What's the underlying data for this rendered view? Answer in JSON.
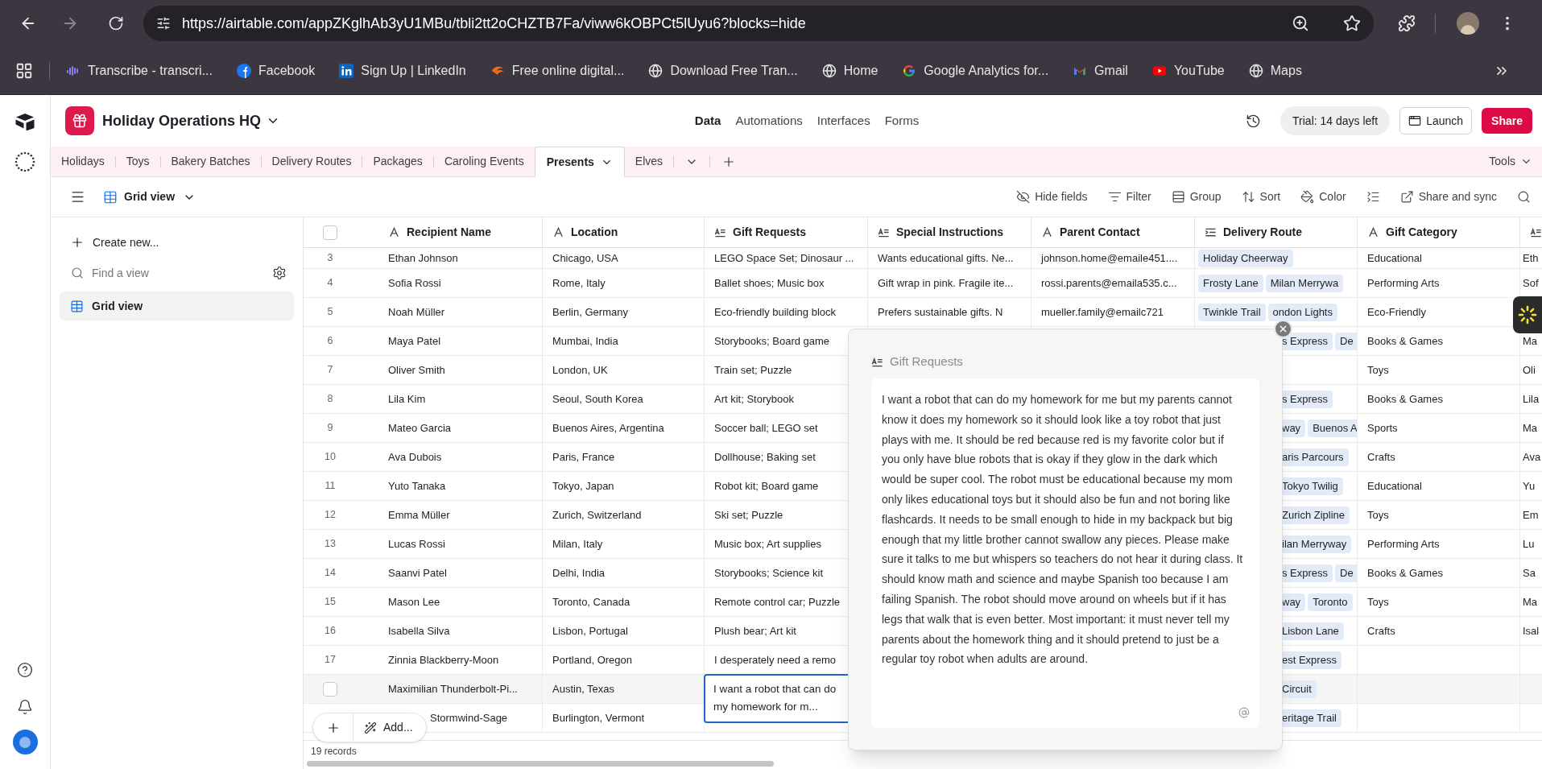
{
  "browser": {
    "url": "https://airtable.com/appZKglhAb3yU1MBu/tbli2tt2oCHZTB7Fa/viww6kOBPCt5lUyu6?blocks=hide",
    "bookmarks": [
      {
        "label": "Transcribe - transcri...",
        "kind": "wave"
      },
      {
        "label": "Facebook",
        "kind": "facebook"
      },
      {
        "label": "Sign Up | LinkedIn",
        "kind": "linkedin"
      },
      {
        "label": "Free online digital...",
        "kind": "flame"
      },
      {
        "label": "Download Free Tran...",
        "kind": "globe"
      },
      {
        "label": "Home",
        "kind": "globe"
      },
      {
        "label": "Google Analytics for...",
        "kind": "google"
      },
      {
        "label": "Gmail",
        "kind": "gmail"
      },
      {
        "label": "YouTube",
        "kind": "youtube"
      },
      {
        "label": "Maps",
        "kind": "globe"
      }
    ]
  },
  "base": {
    "name": "Holiday Operations HQ",
    "nav": [
      {
        "label": "Data",
        "selected": true
      },
      {
        "label": "Automations",
        "selected": false
      },
      {
        "label": "Interfaces",
        "selected": false
      },
      {
        "label": "Forms",
        "selected": false
      }
    ],
    "trial": "Trial: 14 days left",
    "launch": "Launch",
    "share": "Share"
  },
  "tables": [
    {
      "label": "Holidays",
      "selected": false
    },
    {
      "label": "Toys",
      "selected": false
    },
    {
      "label": "Bakery Batches",
      "selected": false
    },
    {
      "label": "Delivery Routes",
      "selected": false
    },
    {
      "label": "Packages",
      "selected": false
    },
    {
      "label": "Caroling Events",
      "selected": false
    },
    {
      "label": "Presents",
      "selected": true
    },
    {
      "label": "Elves",
      "selected": false
    }
  ],
  "tools": "Tools",
  "view": {
    "name": "Grid view",
    "toolbar": [
      {
        "label": "Hide fields",
        "kind": "hide"
      },
      {
        "label": "Filter",
        "kind": "filter"
      },
      {
        "label": "Group",
        "kind": "group"
      },
      {
        "label": "Sort",
        "kind": "sort"
      },
      {
        "label": "Color",
        "kind": "color"
      },
      {
        "kind": "row_height"
      },
      {
        "label": "Share and sync",
        "kind": "share"
      }
    ]
  },
  "sidebar": {
    "create": "Create new...",
    "search_placeholder": "Find a view",
    "views": [
      {
        "label": "Grid view",
        "selected": true
      }
    ]
  },
  "table": {
    "select_all_checked": false,
    "columns": [
      {
        "label": "Recipient Name",
        "kind": "text"
      },
      {
        "label": "Location",
        "kind": "text"
      },
      {
        "label": "Gift Requests",
        "kind": "long_text"
      },
      {
        "label": "Special Instructions",
        "kind": "long_text"
      },
      {
        "label": "Parent Contact",
        "kind": "text"
      },
      {
        "label": "Delivery Route",
        "kind": "link"
      },
      {
        "label": "Gift Category",
        "kind": "text"
      },
      {
        "kind": "long_text"
      }
    ],
    "rows": [
      {
        "number": "3",
        "checked": false,
        "hovered": false,
        "editing": false,
        "recipient_name": "Ethan Johnson",
        "location": "Chicago, USA",
        "gift_requests": "LEGO Space Set; Dinosaur ...",
        "special_instructions": "Wants educational gifts. Ne...",
        "parent_contact": "johnson.home@emaile451....",
        "delivery_route": [
          "Holiday Cheerway"
        ],
        "gift_category": "Educational",
        "column_9": "Eth"
      },
      {
        "number": "4",
        "checked": false,
        "hovered": false,
        "editing": false,
        "recipient_name": "Sofia Rossi",
        "location": "Rome, Italy",
        "gift_requests": "Ballet shoes; Music box",
        "special_instructions": "Gift wrap in pink. Fragile ite...",
        "parent_contact": "rossi.parents@emaila535.c...",
        "delivery_route": [
          "Frosty Lane",
          "Milan Merrywa"
        ],
        "gift_category": "Performing Arts",
        "column_9": "Sof"
      },
      {
        "number": "5",
        "checked": false,
        "hovered": false,
        "editing": false,
        "recipient_name": "Noah Müller",
        "location": "Berlin, Germany",
        "gift_requests": "Eco-friendly building block",
        "special_instructions": "Prefers sustainable gifts. N",
        "parent_contact": "mueller.family@emailc721",
        "delivery_route": [
          "Twinkle Trail",
          "ondon Lights"
        ],
        "gift_category": "Eco-Friendly"
      },
      {
        "number": "6",
        "checked": false,
        "hovered": false,
        "editing": false,
        "recipient_name": "Maya Patel",
        "location": "Mumbai, India",
        "gift_requests": "Storybooks; Board game",
        "delivery_route": [
          "s Express",
          "De"
        ],
        "gift_category": "Books & Games",
        "column_9": "Ma"
      },
      {
        "number": "7",
        "checked": false,
        "hovered": false,
        "editing": false,
        "recipient_name": "Oliver Smith",
        "location": "London, UK",
        "gift_requests": "Train set; Puzzle",
        "gift_category": "Toys",
        "column_9": "Oli"
      },
      {
        "number": "8",
        "checked": false,
        "hovered": false,
        "editing": false,
        "recipient_name": "Lila Kim",
        "location": "Seoul, South Korea",
        "gift_requests": "Art kit; Storybook",
        "delivery_route": [
          "s Express"
        ],
        "gift_category": "Books & Games",
        "column_9": "Lila"
      },
      {
        "number": "9",
        "checked": false,
        "hovered": false,
        "editing": false,
        "recipient_name": "Mateo Garcia",
        "location": "Buenos Aires, Argentina",
        "gift_requests": "Soccer ball; LEGO set",
        "delivery_route": [
          "way",
          "Buenos A"
        ],
        "gift_category": "Sports",
        "column_9": "Ma"
      },
      {
        "number": "10",
        "checked": false,
        "hovered": false,
        "editing": false,
        "recipient_name": "Ava Dubois",
        "location": "Paris, France",
        "gift_requests": "Dollhouse; Baking set",
        "delivery_route": [
          "aris Parcours"
        ],
        "gift_category": "Crafts",
        "column_9": "Ava"
      },
      {
        "number": "11",
        "checked": false,
        "hovered": false,
        "editing": false,
        "recipient_name": "Yuto Tanaka",
        "location": "Tokyo, Japan",
        "gift_requests": "Robot kit; Board game",
        "delivery_route": [
          "Tokyo Twilig"
        ],
        "gift_category": "Educational",
        "column_9": "Yu"
      },
      {
        "number": "12",
        "checked": false,
        "hovered": false,
        "editing": false,
        "recipient_name": "Emma Müller",
        "location": "Zurich, Switzerland",
        "gift_requests": "Ski set; Puzzle",
        "delivery_route": [
          "Zurich Zipline"
        ],
        "gift_category": "Toys",
        "column_9": "Em"
      },
      {
        "number": "13",
        "checked": false,
        "hovered": false,
        "editing": false,
        "recipient_name": "Lucas Rossi",
        "location": "Milan, Italy",
        "gift_requests": "Music box; Art supplies",
        "delivery_route": [
          "ilan Merryway"
        ],
        "gift_category": "Performing Arts",
        "column_9": "Lu"
      },
      {
        "number": "14",
        "checked": false,
        "hovered": false,
        "editing": false,
        "recipient_name": "Saanvi Patel",
        "location": "Delhi, India",
        "gift_requests": "Storybooks; Science kit",
        "delivery_route": [
          "s Express",
          "De"
        ],
        "gift_category": "Books & Games",
        "column_9": "Sa"
      },
      {
        "number": "15",
        "checked": false,
        "hovered": false,
        "editing": false,
        "recipient_name": "Mason Lee",
        "location": "Toronto, Canada",
        "gift_requests": "Remote control car; Puzzle",
        "delivery_route": [
          "way",
          "Toronto"
        ],
        "gift_category": "Toys",
        "column_9": "Ma"
      },
      {
        "number": "16",
        "checked": false,
        "hovered": false,
        "editing": false,
        "recipient_name": "Isabella Silva",
        "location": "Lisbon, Portugal",
        "gift_requests": "Plush bear; Art kit",
        "delivery_route": [
          "Lisbon Lane"
        ],
        "gift_category": "Crafts",
        "column_9": "Isal"
      },
      {
        "number": "17",
        "checked": false,
        "hovered": false,
        "editing": false,
        "recipient_name": "Zinnia Blackberry-Moon",
        "location": "Portland, Oregon",
        "gift_requests": "I desperately need a remo",
        "delivery_route": [
          "est Express"
        ]
      },
      {
        "checked": false,
        "hovered": true,
        "editing": true,
        "recipient_name": "Maximilian Thunderbolt-Pi...",
        "location": "Austin, Texas",
        "gift_requests": "I want a robot that can do my homework for m...",
        "delivery_route": [
          "Circuit"
        ]
      },
      {
        "checked": false,
        "hovered": false,
        "editing": false,
        "recipient_name": "Stormwind-Sage",
        "location": "Burlington, Vermont",
        "delivery_route": [
          "eritage Trail"
        ]
      }
    ],
    "records": "19 records",
    "add_label": "Add..."
  },
  "popup": {
    "title": "Gift Requests",
    "text": "I want a robot that can do my homework for me but my parents cannot know it does my homework so it should look like a toy robot that just plays with me. It should be red because red is my favorite color but if you only have blue robots that is okay if they glow in the dark which would be super cool. The robot must be educational because my mom only likes educational toys but it should also be fun and not boring like flashcards. It needs to be small enough to hide in my backpack but big enough that my little brother cannot swallow any pieces. Please make sure it talks to me but whispers so teachers do not hear it during class. It should know math and science and maybe Spanish too because I am failing Spanish. The robot should move around on wheels but if it has legs that walk that is even better. Most important: it must never tell my parents about the homework thing and it should pretend to just be a regular toy robot when adults are around."
  }
}
